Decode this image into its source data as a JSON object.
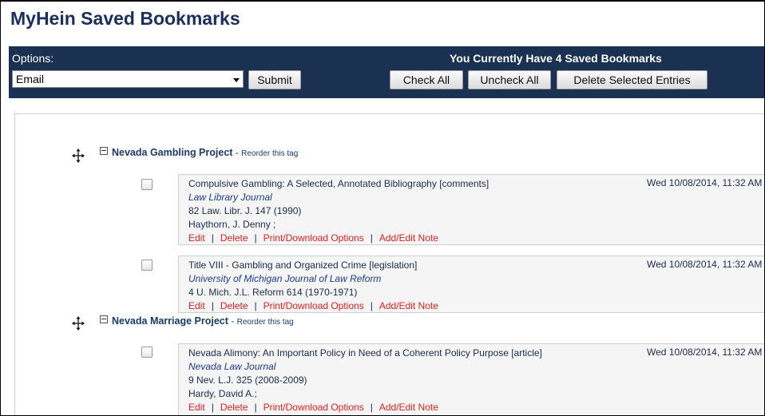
{
  "page": {
    "title": "MyHein Saved Bookmarks"
  },
  "options": {
    "label": "Options:",
    "selected": "Email",
    "submit_label": "Submit",
    "count_text": "You Currently Have 4 Saved Bookmarks",
    "check_all_label": "Check All",
    "uncheck_all_label": "Uncheck All",
    "delete_selected_label": "Delete Selected Entries"
  },
  "tags": [
    {
      "name": "Nevada Gambling Project",
      "separator": "-",
      "reorder": "Reorder this tag"
    },
    {
      "name": "Nevada Marriage Project",
      "separator": "-",
      "reorder": "Reorder this tag"
    }
  ],
  "entries": [
    {
      "title": "Compulsive Gambling: A Selected, Annotated Bibliography [comments]",
      "journal": "Law Library Journal",
      "citation": "82 Law. Libr. J. 147 (1990)",
      "author": "Haythorn, J. Denny ;",
      "date": "Wed 10/08/2014, 11:32 AM"
    },
    {
      "title": "Title VIII - Gambling and Organized Crime [legislation]",
      "journal": "University of Michigan Journal of Law Reform",
      "citation": "4 U. Mich. J.L. Reform 614 (1970-1971)",
      "author": "",
      "date": "Wed 10/08/2014, 11:32 AM"
    },
    {
      "title": "Nevada Alimony: An Important Policy in Need of a Coherent Policy Purpose [article]",
      "journal": "Nevada Law Journal",
      "citation": "9 Nev. L.J. 325 (2008-2009)",
      "author": "Hardy, David A.;",
      "date": "Wed 10/08/2014, 11:32 AM"
    }
  ],
  "actions": {
    "edit": "Edit",
    "delete": "Delete",
    "print": "Print/Download Options",
    "note": "Add/Edit Note",
    "separator": "|"
  }
}
